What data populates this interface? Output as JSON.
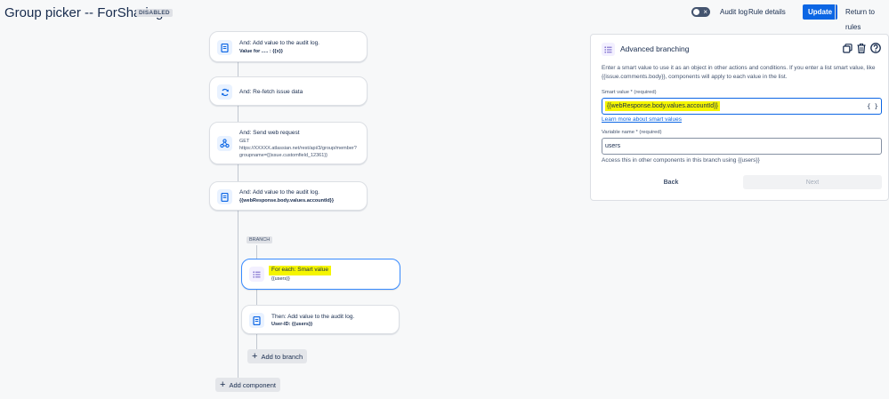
{
  "header": {
    "title": "Group picker -- ForSharing",
    "status": "DISABLED",
    "audit_log": "Audit log",
    "rule_details": "Rule details",
    "update": "Update",
    "return": "Return to rules"
  },
  "flow": {
    "components": [
      {
        "title": "And: Add value to the audit log.",
        "detail": "Value for ..... : {{x}}",
        "icon": "audit-log-icon"
      },
      {
        "title": "And: Re-fetch issue data",
        "detail": "",
        "icon": "refresh-icon"
      },
      {
        "title": "And: Send web request",
        "detail_lines": [
          "GET",
          "https://XXXXX.atlassian.net/rest/api/3/group/member?",
          "groupname={{issue.customfield_12361}}"
        ],
        "icon": "webhook-icon"
      },
      {
        "title": "And: Add value to the audit log.",
        "detail": "{{webResponse.body.values.accountId}}",
        "icon": "audit-log-icon"
      }
    ],
    "branch_label": "BRANCH",
    "branch_components": [
      {
        "title": "For each: Smart value",
        "detail": "{{users}}",
        "icon": "branch-list-icon"
      },
      {
        "title": "Then: Add value to the audit log.",
        "detail": "User-ID: {{users}}",
        "icon": "audit-log-icon"
      }
    ],
    "add_to_branch": "Add to branch",
    "add_component": "Add component"
  },
  "panel": {
    "title": "Advanced branching",
    "description": "Enter a smart value to use it as an object in other actions and conditions. If you enter a list smart value, like {{issue.comments.body}}, components will apply to each value in the list.",
    "smart_value_label": "Smart value * (required)",
    "smart_value": "{{webResponse.body.values.accountId}}",
    "learn_more": "Learn more about smart values",
    "variable_label": "Variable name * (required)",
    "variable_value": "users",
    "hint": "Access this in other components in this branch using {{users}}",
    "back": "Back",
    "next": "Next"
  },
  "colors": {
    "accent": "#0c66e4",
    "highlight": "#f5f500",
    "selected_border": "#388bff"
  }
}
